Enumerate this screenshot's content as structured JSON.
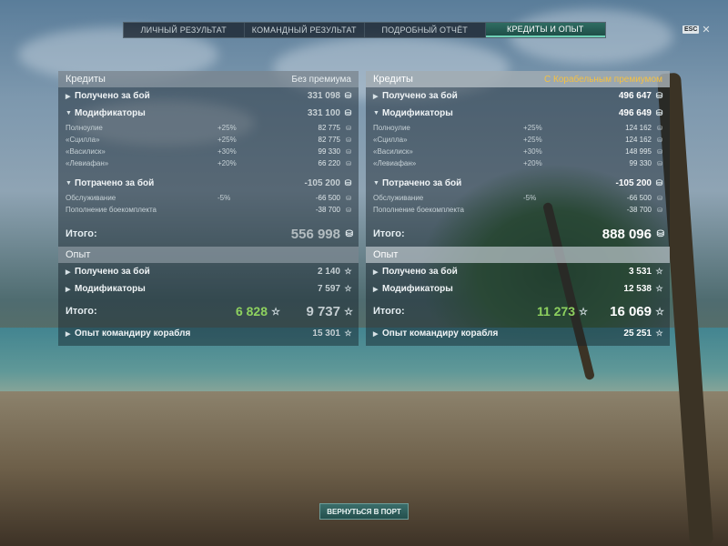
{
  "tabs": [
    {
      "label": "ЛИЧНЫЙ РЕЗУЛЬТАТ",
      "active": false
    },
    {
      "label": "КОМАНДНЫЙ РЕЗУЛЬТАТ",
      "active": false
    },
    {
      "label": "ПОДРОБНЫЙ ОТЧЁТ",
      "active": false
    },
    {
      "label": "КРЕДИТЫ И ОПЫТ",
      "active": true
    }
  ],
  "esc_label": "ESC",
  "left": {
    "credits_title": "Кредиты",
    "credits_mode": "Без премиума",
    "earned_label": "Получено за бой",
    "earned_value": "331 098",
    "mods_label": "Модификаторы",
    "mods_value": "331 100",
    "mods": [
      {
        "label": "Полноулие",
        "pct": "+25%",
        "value": "82 775"
      },
      {
        "label": "«Сцилла»",
        "pct": "+25%",
        "value": "82 775"
      },
      {
        "label": "«Василиск»",
        "pct": "+30%",
        "value": "99 330"
      },
      {
        "label": "«Левиафан»",
        "pct": "+20%",
        "value": "66 220"
      }
    ],
    "spent_label": "Потрачено за бой",
    "spent_value": "-105 200",
    "spent": [
      {
        "label": "Обслуживание",
        "pct": "-5%",
        "value": "-66 500"
      },
      {
        "label": "Пополнение боекомплекта",
        "pct": "",
        "value": "-38 700"
      }
    ],
    "total_label": "Итого:",
    "total_value": "556 998",
    "xp_title": "Опыт",
    "xp_earned_label": "Получено за бой",
    "xp_earned_value": "2 140",
    "xp_mods_label": "Модификаторы",
    "xp_mods_value": "7 597",
    "xp_total_label": "Итого:",
    "xp_total_green": "6 828",
    "xp_total_value": "9 737",
    "cmdr_label": "Опыт командиру корабля",
    "cmdr_value": "15 301"
  },
  "right": {
    "credits_title": "Кредиты",
    "credits_mode": "С Корабельным премиумом",
    "earned_label": "Получено за бой",
    "earned_value": "496 647",
    "mods_label": "Модификаторы",
    "mods_value": "496 649",
    "mods": [
      {
        "label": "Полноулие",
        "pct": "+25%",
        "value": "124 162"
      },
      {
        "label": "«Сцилла»",
        "pct": "+25%",
        "value": "124 162"
      },
      {
        "label": "«Василиск»",
        "pct": "+30%",
        "value": "148 995"
      },
      {
        "label": "«Левиафан»",
        "pct": "+20%",
        "value": "99 330"
      }
    ],
    "spent_label": "Потрачено за бой",
    "spent_value": "-105 200",
    "spent": [
      {
        "label": "Обслуживание",
        "pct": "-5%",
        "value": "-66 500"
      },
      {
        "label": "Пополнение боекомплекта",
        "pct": "",
        "value": "-38 700"
      }
    ],
    "total_label": "Итого:",
    "total_value": "888 096",
    "xp_title": "Опыт",
    "xp_earned_label": "Получено за бой",
    "xp_earned_value": "3 531",
    "xp_mods_label": "Модификаторы",
    "xp_mods_value": "12 538",
    "xp_total_label": "Итого:",
    "xp_total_green": "11 273",
    "xp_total_value": "16 069",
    "cmdr_label": "Опыт командиру корабля",
    "cmdr_value": "25 251"
  },
  "port_button": "ВЕРНУТЬСЯ В ПОРТ",
  "icons": {
    "credit": "credit-coin-icon",
    "xp": "xp-star-icon",
    "expand": "triangle-right-icon",
    "collapse": "triangle-down-icon"
  },
  "colors": {
    "premium": "#f4c043",
    "xp_green": "#8ed15f",
    "tab_active": "#2f6c62"
  }
}
